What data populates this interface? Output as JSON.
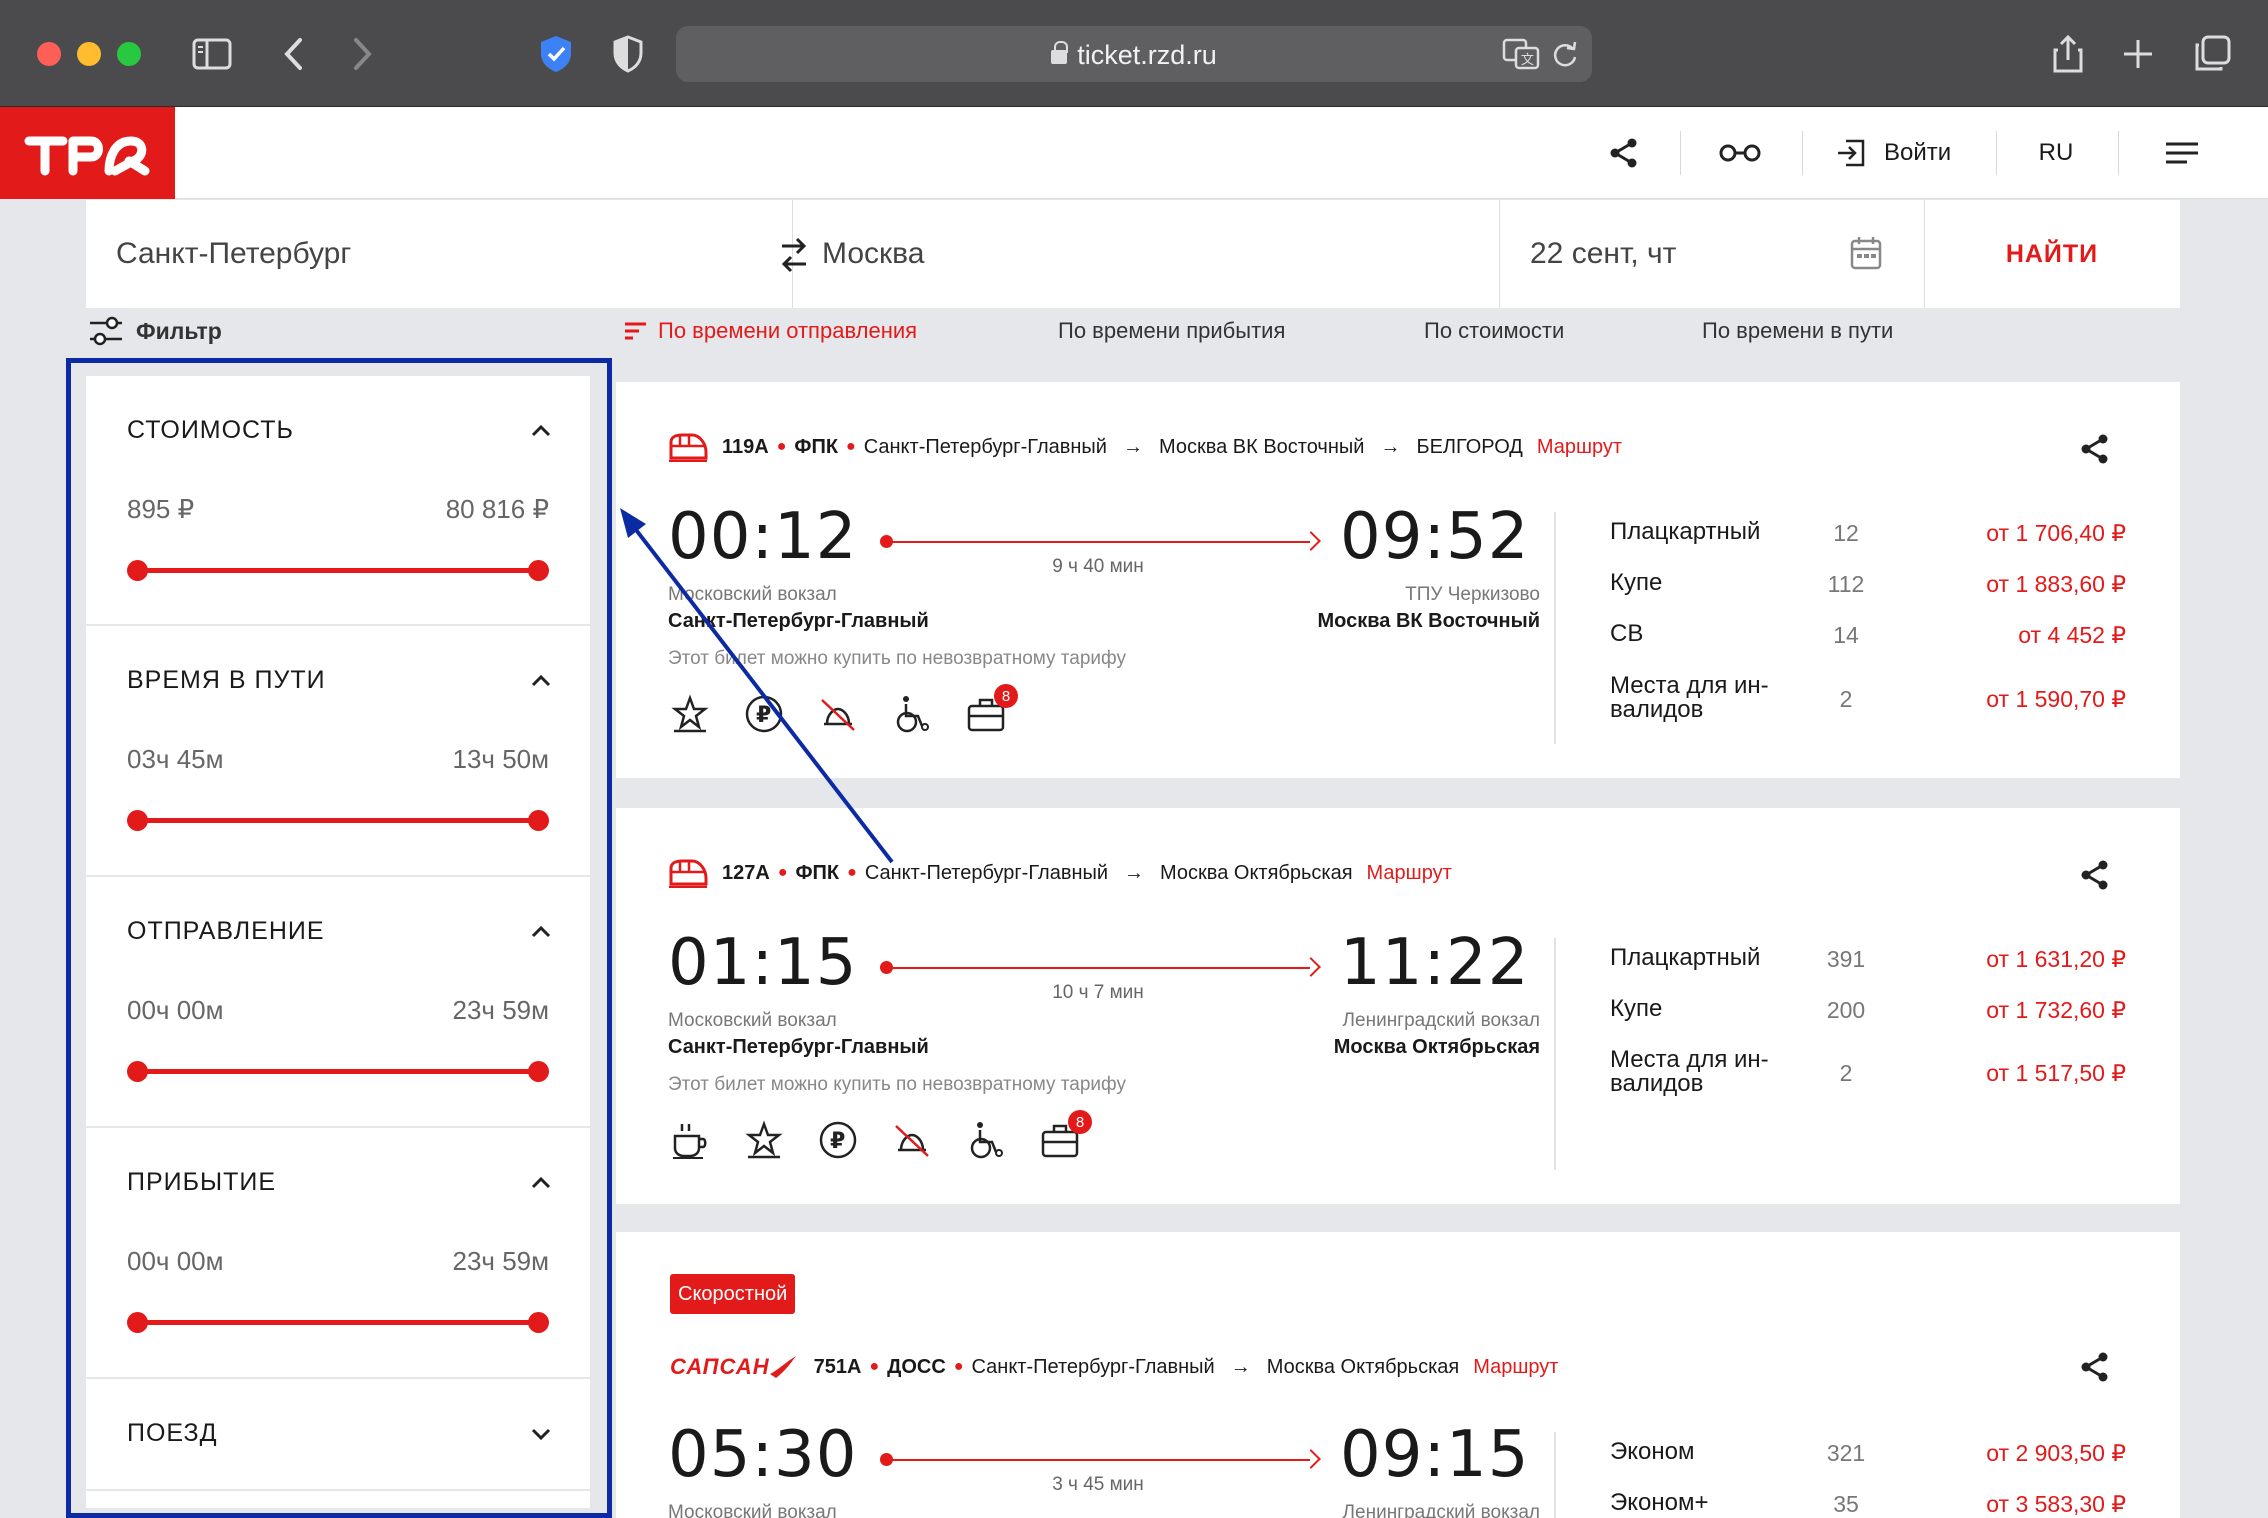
{
  "browser": {
    "url": "ticket.rzd.ru"
  },
  "header": {
    "login_label": "Войти",
    "lang": "RU"
  },
  "search": {
    "from": "Санкт-Петербург",
    "to": "Москва",
    "date": "22 сент, чт",
    "find_label": "НАЙТИ"
  },
  "sort": {
    "filter_label": "Фильтр",
    "options": [
      "По времени отправления",
      "По времени прибытия",
      "По стоимости",
      "По времени в пути"
    ],
    "active_index": 0
  },
  "filters": [
    {
      "title": "СТОИМОСТЬ",
      "min": "895 ₽",
      "max": "80 816 ₽",
      "expanded": true
    },
    {
      "title": "ВРЕМЯ В ПУТИ",
      "min": "03ч 45м",
      "max": "13ч 50м",
      "expanded": true
    },
    {
      "title": "ОТПРАВЛЕНИЕ",
      "min": "00ч 00м",
      "max": "23ч 59м",
      "expanded": true
    },
    {
      "title": "ПРИБЫТИЕ",
      "min": "00ч 00м",
      "max": "23ч 59м",
      "expanded": true
    },
    {
      "title": "ПОЕЗД",
      "expanded": false
    }
  ],
  "trains": [
    {
      "number": "119А",
      "carrier": "ФПК",
      "from": "Санкт-Петербург-Главный",
      "via": "Москва ВК Восточный",
      "to": "БЕЛГОРОД",
      "route_label": "Маршрут",
      "dep_time": "00:12",
      "arr_time": "09:52",
      "duration": "9 ч 40 мин",
      "dep_station_sub": "Московский вокзал",
      "dep_station": "Санкт-Петербург-Главный",
      "arr_station_sub": "ТПУ Черкизово",
      "arr_station": "Москва ВК Восточный",
      "nonrefund": "Этот билет можно купить по невозвратному тарифу",
      "amenity_badge": "8",
      "seats": [
        {
          "name": "Плацкартный",
          "count": "12",
          "price": "от 1 706,40 ₽"
        },
        {
          "name": "Купе",
          "count": "112",
          "price": "от 1 883,60 ₽"
        },
        {
          "name": "СВ",
          "count": "14",
          "price": "от 4 452 ₽"
        },
        {
          "name": "Места для ин-\nвалидов",
          "count": "2",
          "price": "от 1 590,70 ₽"
        }
      ]
    },
    {
      "number": "127А",
      "carrier": "ФПК",
      "from": "Санкт-Петербург-Главный",
      "to": "Москва Октябрьская",
      "route_label": "Маршрут",
      "dep_time": "01:15",
      "arr_time": "11:22",
      "duration": "10 ч 7 мин",
      "dep_station_sub": "Московский вокзал",
      "dep_station": "Санкт-Петербург-Главный",
      "arr_station_sub": "Ленинградский вокзал",
      "arr_station": "Москва Октябрьская",
      "nonrefund": "Этот билет можно купить по невозвратному тарифу",
      "amenity_badge": "8",
      "seats": [
        {
          "name": "Плацкартный",
          "count": "391",
          "price": "от 1 631,20 ₽"
        },
        {
          "name": "Купе",
          "count": "200",
          "price": "от 1 732,60 ₽"
        },
        {
          "name": "Места для ин-\nвалидов",
          "count": "2",
          "price": "от 1 517,50 ₽"
        }
      ]
    },
    {
      "tag": "Скоростной",
      "brand": "САПСАН",
      "number": "751А",
      "carrier": "ДОСС",
      "from": "Санкт-Петербург-Главный",
      "to": "Москва Октябрьская",
      "route_label": "Маршрут",
      "dep_time": "05:30",
      "arr_time": "09:15",
      "duration": "3 ч 45 мин",
      "dep_station_sub": "Московский вокзал",
      "arr_station_sub": "Ленинградский вокзал",
      "seats": [
        {
          "name": "Эконом",
          "count": "321",
          "price": "от 2 903,50 ₽"
        },
        {
          "name": "Эконом+",
          "count": "35",
          "price": "от 3 583,30 ₽"
        }
      ]
    }
  ],
  "colors": {
    "accent": "#e21a1a",
    "annotation": "#0c2aa3"
  }
}
